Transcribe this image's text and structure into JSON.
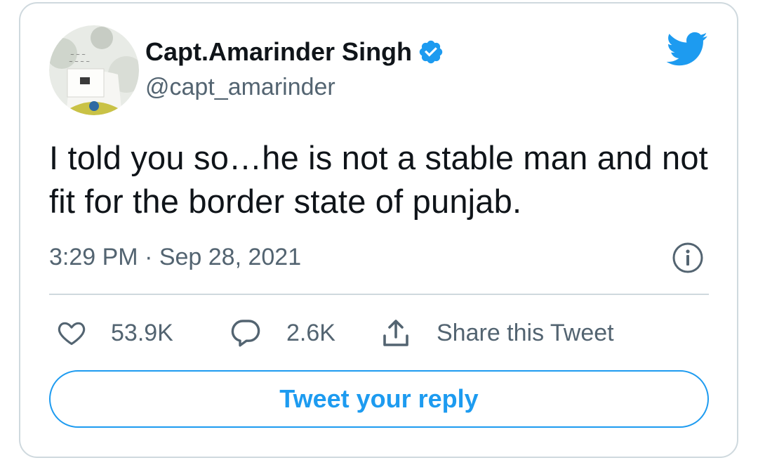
{
  "author": {
    "name": "Capt.Amarinder Singh",
    "handle": "@capt_amarinder",
    "verified": true,
    "avatar_icon": "profile-photo"
  },
  "tweet": {
    "text": "I told you so…he is not a stable man and not fit for the border state of punjab.",
    "timestamp": "3:29 PM · Sep 28, 2021"
  },
  "actions": {
    "likes": "53.9K",
    "replies": "2.6K",
    "share_label": "Share this Tweet"
  },
  "reply_button_label": "Tweet your reply",
  "colors": {
    "accent": "#1d9bf0",
    "text": "#0f1419",
    "secondary": "#536471",
    "border": "#cfd9de"
  },
  "icons": {
    "logo": "twitter-bird-icon",
    "verified": "verified-badge-icon",
    "info": "info-icon",
    "like": "heart-icon",
    "reply": "speech-bubble-icon",
    "share": "share-upload-icon"
  }
}
